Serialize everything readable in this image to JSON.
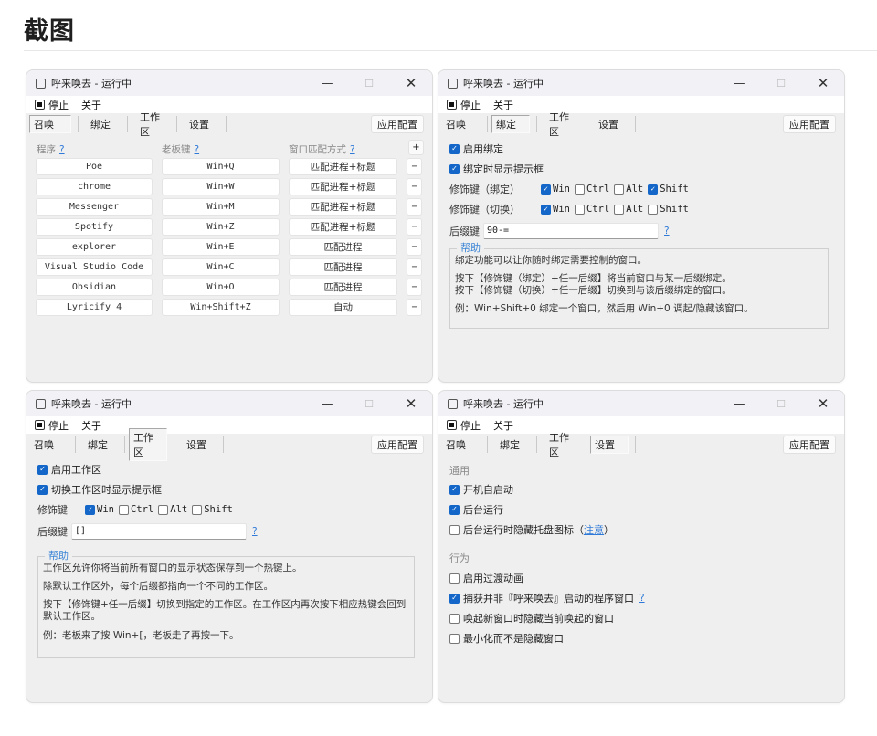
{
  "page": {
    "title": "截图"
  },
  "window_common": {
    "title": "呼来唤去 - 运行中",
    "menu": {
      "stop": "停止",
      "about": "关于"
    },
    "tabs": [
      "召唤",
      "绑定",
      "工作区",
      "设置"
    ],
    "apply_button": "应用配置",
    "controls": {
      "minimize": "—",
      "maximize": "☐",
      "close": "✕"
    },
    "help_marker": "?"
  },
  "summon": {
    "active_tab": "召唤",
    "headers": {
      "program": "程序",
      "hotkey": "老板键",
      "match": "窗口匹配方式"
    },
    "add_button": "+",
    "remove_button": "−",
    "rows": [
      {
        "program": "Poe",
        "hotkey": "Win+Q",
        "match": "匹配进程+标题"
      },
      {
        "program": "chrome",
        "hotkey": "Win+W",
        "match": "匹配进程+标题"
      },
      {
        "program": "Messenger",
        "hotkey": "Win+M",
        "match": "匹配进程+标题"
      },
      {
        "program": "Spotify",
        "hotkey": "Win+Z",
        "match": "匹配进程+标题"
      },
      {
        "program": "explorer",
        "hotkey": "Win+E",
        "match": "匹配进程"
      },
      {
        "program": "Visual Studio Code",
        "hotkey": "Win+C",
        "match": "匹配进程"
      },
      {
        "program": "Obsidian",
        "hotkey": "Win+O",
        "match": "匹配进程"
      },
      {
        "program": "Lyricify 4",
        "hotkey": "Win+Shift+Z",
        "match": "自动"
      }
    ]
  },
  "bind": {
    "active_tab": "绑定",
    "enable": {
      "label": "启用绑定",
      "checked": true
    },
    "show_tip": {
      "label": "绑定时显示提示框",
      "checked": true
    },
    "mod_bind": {
      "label": "修饰键（绑定）",
      "keys": [
        {
          "label": "Win",
          "checked": true
        },
        {
          "label": "Ctrl",
          "checked": false
        },
        {
          "label": "Alt",
          "checked": false
        },
        {
          "label": "Shift",
          "checked": true
        }
      ]
    },
    "mod_switch": {
      "label": "修饰键（切换）",
      "keys": [
        {
          "label": "Win",
          "checked": true
        },
        {
          "label": "Ctrl",
          "checked": false
        },
        {
          "label": "Alt",
          "checked": false
        },
        {
          "label": "Shift",
          "checked": false
        }
      ]
    },
    "suffix_label": "后缀键",
    "suffix_value": "90-=",
    "help_title": "帮助",
    "help_lines": [
      "绑定功能可以让你随时绑定需要控制的窗口。",
      "按下【修饰键（绑定）+任一后缀】将当前窗口与某一后缀绑定。",
      "按下【修饰键（切换）+任一后缀】切换到与该后缀绑定的窗口。",
      "例：Win+Shift+0 绑定一个窗口，然后用 Win+0 调起/隐藏该窗口。"
    ]
  },
  "workspace": {
    "active_tab": "工作区",
    "enable": {
      "label": "启用工作区",
      "checked": true
    },
    "show_tip": {
      "label": "切换工作区时显示提示框",
      "checked": true
    },
    "mod": {
      "label": "修饰键",
      "keys": [
        {
          "label": "Win",
          "checked": true
        },
        {
          "label": "Ctrl",
          "checked": false
        },
        {
          "label": "Alt",
          "checked": false
        },
        {
          "label": "Shift",
          "checked": false
        }
      ]
    },
    "suffix_label": "后缀键",
    "suffix_value": "[]",
    "help_title": "帮助",
    "help_lines": [
      "工作区允许你将当前所有窗口的显示状态保存到一个热键上。",
      "除默认工作区外，每个后缀都指向一个不同的工作区。",
      "按下【修饰键+任一后缀】切换到指定的工作区。在工作区内再次按下相应热键会回到默认工作区。",
      "例：老板来了按 Win+[，老板走了再按一下。"
    ]
  },
  "settings": {
    "active_tab": "设置",
    "general_label": "通用",
    "general": [
      {
        "label": "开机自启动",
        "checked": true
      },
      {
        "label": "后台运行",
        "checked": true
      },
      {
        "label": "后台运行时隐藏托盘图标",
        "checked": false,
        "link_pre": "（",
        "link": "注意",
        "link_post": "）"
      }
    ],
    "behavior_label": "行为",
    "behavior": [
      {
        "label": "启用过渡动画",
        "checked": false
      },
      {
        "label": "捕获并非『呼来唤去』启动的程序窗口",
        "checked": true,
        "help": "?"
      },
      {
        "label": "唤起新窗口时隐藏当前唤起的窗口",
        "checked": false
      },
      {
        "label": "最小化而不是隐藏窗口",
        "checked": false
      }
    ]
  }
}
